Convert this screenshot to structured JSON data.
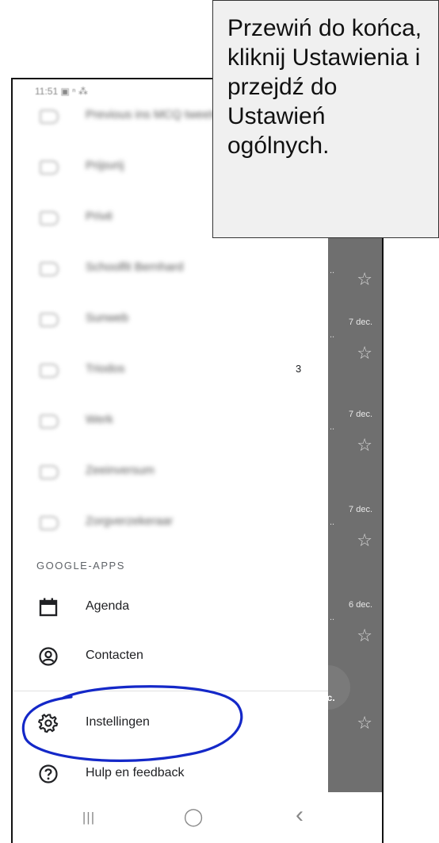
{
  "status_bar": {
    "time": "11:51"
  },
  "labels": [
    {
      "text": "Previous ins MCQ tweets",
      "count": ""
    },
    {
      "text": "Prijsvrij",
      "count": ""
    },
    {
      "text": "Privé",
      "count": ""
    },
    {
      "text": "Schoolfit Bernhard",
      "count": ""
    },
    {
      "text": "Sunweb",
      "count": ""
    },
    {
      "text": "Triodos",
      "count": "3"
    },
    {
      "text": "Werk",
      "count": ""
    },
    {
      "text": "Zeeinversum",
      "count": ""
    },
    {
      "text": "Zorgverzekeraar",
      "count": ""
    }
  ],
  "inbox_dates": [
    "7 dec.",
    "7 dec.",
    "7 dec.",
    "6 dec."
  ],
  "google_apps": {
    "header": "GOOGLE-APPS",
    "items": [
      {
        "label": "Agenda",
        "icon": "calendar-icon"
      },
      {
        "label": "Contacten",
        "icon": "contacts-icon"
      }
    ]
  },
  "settings": [
    {
      "label": "Instellingen",
      "icon": "gear-icon"
    },
    {
      "label": "Hulp en feedback",
      "icon": "help-icon"
    }
  ],
  "fab_text": "n    c.",
  "navbar": {
    "recents": "|||",
    "home": "◯",
    "back": "‹"
  },
  "callout_text": "Przewiń do końca, kliknij Ustawienia i przejdź do Ustawień ogólnych.",
  "colors": {
    "annotation": "#1428c8",
    "scrim": "#6f6f6f"
  }
}
